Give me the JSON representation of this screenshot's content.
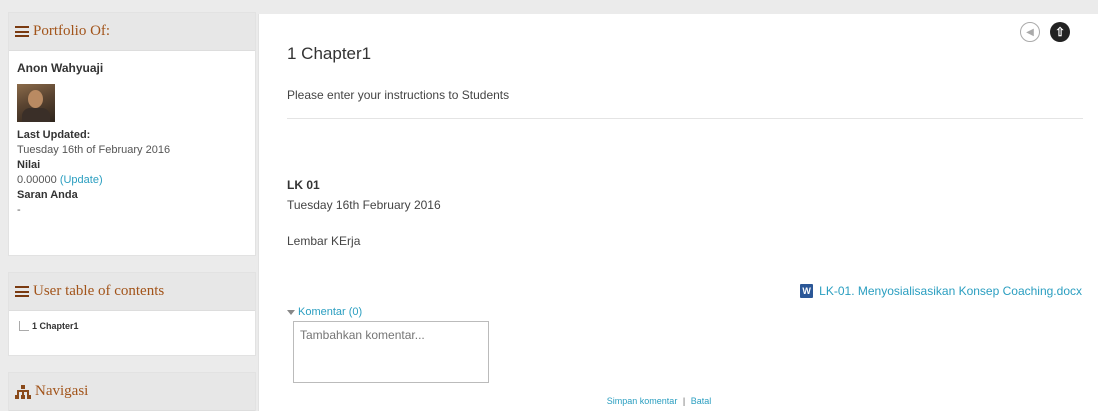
{
  "sidebar": {
    "portfolio": {
      "title": "Portfolio Of:",
      "owner_name": "Anon Wahyuaji",
      "last_updated_label": "Last Updated:",
      "last_updated_value": "Tuesday 16th of February 2016",
      "grade_label": "Nilai",
      "grade_value": "0.00000",
      "grade_update_link": "(Update)",
      "feedback_label": "Saran Anda",
      "feedback_value": "-"
    },
    "user_toc": {
      "title": "User table of contents",
      "items": [
        {
          "label": "1 Chapter1"
        }
      ]
    },
    "navigation": {
      "title": "Navigasi"
    }
  },
  "main": {
    "chapter_title": "1 Chapter1",
    "instructions": "Please enter your instructions to Students",
    "entry": {
      "title": "LK 01",
      "date": "Tuesday 16th February 2016",
      "text": "Lembar KErja",
      "attachment_name": "LK-01. Menyosialisasikan Konsep Coaching.docx"
    },
    "comments": {
      "toggle_label": "Komentar (0)",
      "placeholder": "Tambahkan komentar...",
      "save_label": "Simpan komentar",
      "separator": "|",
      "cancel_label": "Batal"
    }
  },
  "icons": {
    "prev": "circle-arrow-left-icon",
    "up": "circle-arrow-up-icon",
    "menu": "hamburger-icon",
    "navigation": "sitemap-icon",
    "attachment": "word-document-icon"
  },
  "colors": {
    "block_title": "#a2541a",
    "link": "#2a9ec0",
    "header_bg": "#e7e7e7"
  }
}
